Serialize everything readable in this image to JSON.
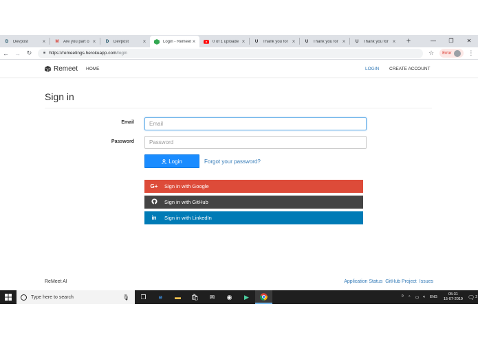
{
  "browser": {
    "tabs": [
      {
        "title": "Devpost",
        "favicon": "D",
        "favicon_color": "#003e54",
        "active": false
      },
      {
        "title": "Are you part o",
        "favicon": "M",
        "favicon_color": "#d93025",
        "active": false
      },
      {
        "title": "Devpost",
        "favicon": "D",
        "favicon_color": "#003e54",
        "active": false
      },
      {
        "title": "Login - Remeet",
        "favicon": "cube",
        "favicon_color": "#34a853",
        "active": true
      },
      {
        "title": "0 of 1 uploade",
        "favicon": "yt",
        "favicon_color": "#ff0000",
        "active": false
      },
      {
        "title": "Thank you for",
        "favicon": "U",
        "favicon_color": "#202124",
        "active": false
      },
      {
        "title": "Thank you for",
        "favicon": "U",
        "favicon_color": "#202124",
        "active": false
      },
      {
        "title": "Thank you for",
        "favicon": "U",
        "favicon_color": "#202124",
        "active": false
      }
    ],
    "close_glyph": "×",
    "newtab_glyph": "+",
    "window_controls": {
      "minimize": "—",
      "restore": "❐",
      "close": "✕"
    },
    "url_host": "https://remeetings.herokuapp.com",
    "url_path": "/login",
    "error_label": "Error"
  },
  "site": {
    "brand": "Remeet",
    "nav_home": "HOME",
    "nav_login": "LOGIN",
    "nav_create": "CREATE ACCOUNT"
  },
  "form": {
    "title": "Sign in",
    "email_label": "Email",
    "email_placeholder": "Email",
    "password_label": "Password",
    "password_placeholder": "Password",
    "login_button": "Login",
    "forgot_link": "Forgot your password?",
    "google_icon": "G+",
    "google_label": "Sign in with Google",
    "github_label": "Sign in with GitHub",
    "linkedin_icon": "in",
    "linkedin_label": "Sign in with LinkedIn"
  },
  "footer": {
    "brand": "ReMeet AI",
    "links": [
      "Application Status",
      "GitHub Project",
      "Issues"
    ]
  },
  "taskbar": {
    "search_placeholder": "Type here to search",
    "time": "05:31",
    "date": "15-07-2019",
    "notification_count": "2",
    "language": "ENG"
  },
  "colors": {
    "primary": "#1a8cff",
    "google": "#dd4b39",
    "github": "#444444",
    "linkedin": "#007bb6",
    "link": "#337ab7"
  }
}
